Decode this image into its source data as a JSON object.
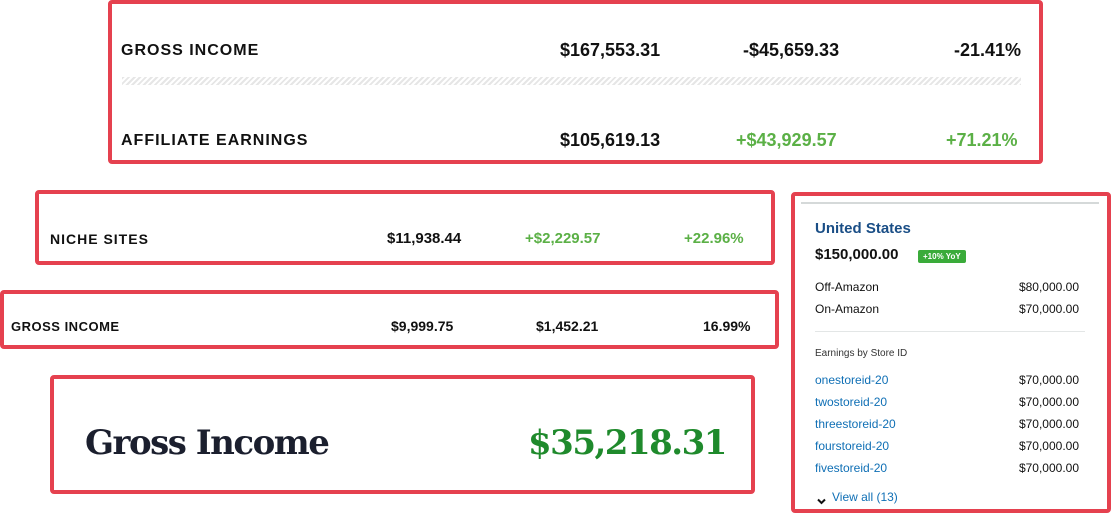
{
  "top_panel": {
    "rows": [
      {
        "label": "GROSS INCOME",
        "amount": "$167,553.31",
        "change": "-$45,659.33",
        "percent": "-21.41%"
      },
      {
        "label": "AFFILIATE EARNINGS",
        "amount": "$105,619.13",
        "change": "+$43,929.57",
        "percent": "+71.21%"
      }
    ]
  },
  "niche_panel": {
    "label": "NICHE SITES",
    "amount": "$11,938.44",
    "change": "+$2,229.57",
    "percent": "+22.96%"
  },
  "gross_small_panel": {
    "label": "GROSS INCOME",
    "amount": "$9,999.75",
    "change": "$1,452.21",
    "percent": "16.99%"
  },
  "serif_panel": {
    "label": "Gross Income",
    "amount": "$35,218.31"
  },
  "amazon_panel": {
    "region": "United States",
    "total": "$150,000.00",
    "badge": "+10% YoY",
    "breakdown": [
      {
        "label": "Off-Amazon",
        "value": "$80,000.00"
      },
      {
        "label": "On-Amazon",
        "value": "$70,000.00"
      }
    ],
    "store_heading": "Earnings by Store ID",
    "stores": [
      {
        "id": "onestoreid-20",
        "value": "$70,000.00"
      },
      {
        "id": "twostoreid-20",
        "value": "$70,000.00"
      },
      {
        "id": "threestoreid-20",
        "value": "$70,000.00"
      },
      {
        "id": "fourstoreid-20",
        "value": "$70,000.00"
      },
      {
        "id": "fivestoreid-20",
        "value": "$70,000.00"
      }
    ],
    "view_all": "View all (13)"
  },
  "colors": {
    "border": "#e5414f",
    "green": "#5bb046",
    "dark_green": "#1f8a2c",
    "link": "#0f6fb5"
  }
}
